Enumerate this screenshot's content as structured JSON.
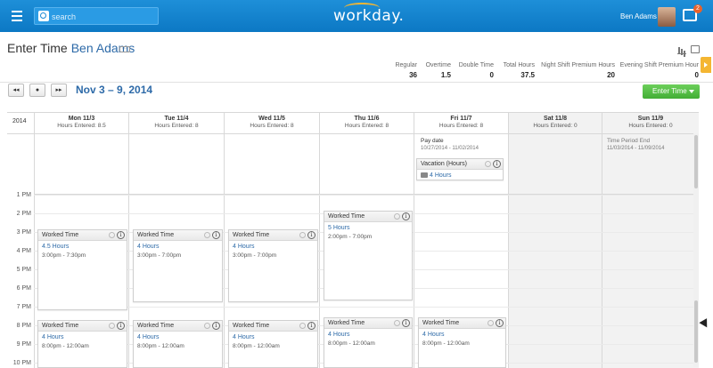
{
  "topbar": {
    "search_placeholder": "search",
    "logo": "workday.",
    "user_name": "Ben Adams",
    "inbox_count": "2"
  },
  "header": {
    "title": "Enter Time",
    "worker": "Ben Adams",
    "more": "···"
  },
  "totals": [
    {
      "label": "Regular",
      "value": "36"
    },
    {
      "label": "Overtime",
      "value": "1.5"
    },
    {
      "label": "Double Time",
      "value": "0"
    },
    {
      "label": "Total Hours",
      "value": "37.5"
    },
    {
      "label": "Night Shift Premium Hours",
      "value": "20"
    },
    {
      "label": "Evening Shift Premium Hour",
      "value": "0"
    }
  ],
  "nav": {
    "prev": "◂◂",
    "today": "●",
    "next": "▸▸",
    "date_range": "Nov 3 – 9, 2014",
    "enter_time_button": "Enter Time"
  },
  "calendar": {
    "year": "2014",
    "days": [
      {
        "day": "Mon 11/3",
        "hours": "Hours Entered: 8.5"
      },
      {
        "day": "Tue 11/4",
        "hours": "Hours Entered: 8"
      },
      {
        "day": "Wed 11/5",
        "hours": "Hours Entered: 8"
      },
      {
        "day": "Thu 11/6",
        "hours": "Hours Entered: 8"
      },
      {
        "day": "Fri 11/7",
        "hours": "Hours Entered: 8"
      },
      {
        "day": "Sat 11/8",
        "hours": "Hours Entered: 0"
      },
      {
        "day": "Sun 11/9",
        "hours": "Hours Entered: 0"
      }
    ],
    "hours": [
      "1 PM",
      "2 PM",
      "3 PM",
      "4 PM",
      "5 PM",
      "6 PM",
      "7 PM",
      "8 PM",
      "9 PM",
      "10 PM"
    ],
    "pay_date": {
      "label": "Pay date",
      "range": "10/27/2014 - 11/02/2014"
    },
    "vacation": {
      "title": "Vacation (Hours)",
      "hours": "4 Hours"
    },
    "period_end": {
      "label": "Time Period End",
      "range": "11/03/2014 - 11/09/2014"
    },
    "events": [
      {
        "title": "Worked Time",
        "hours": "4.5 Hours",
        "time": "3:00pm - 7:30pm"
      },
      {
        "title": "Worked Time",
        "hours": "4 Hours",
        "time": "3:00pm - 7:00pm"
      },
      {
        "title": "Worked Time",
        "hours": "4 Hours",
        "time": "3:00pm - 7:00pm"
      },
      {
        "title": "Worked Time",
        "hours": "5 Hours",
        "time": "2:00pm - 7:00pm"
      },
      {
        "title": "Worked Time",
        "hours": "4 Hours",
        "time": "8:00pm - 12:00am"
      },
      {
        "title": "Worked Time",
        "hours": "4 Hours",
        "time": "8:00pm - 12:00am"
      },
      {
        "title": "Worked Time",
        "hours": "4 Hours",
        "time": "8:00pm - 12:00am"
      },
      {
        "title": "Worked Time",
        "hours": "4 Hours",
        "time": "8:00pm - 12:00am"
      },
      {
        "title": "Worked Time",
        "hours": "4 Hours",
        "time": "8:00pm - 12:00am"
      }
    ]
  },
  "colors": {
    "brand": "#0c78c4",
    "accent": "#f4b632",
    "link": "#2d6aa8",
    "action": "#42ae35"
  }
}
